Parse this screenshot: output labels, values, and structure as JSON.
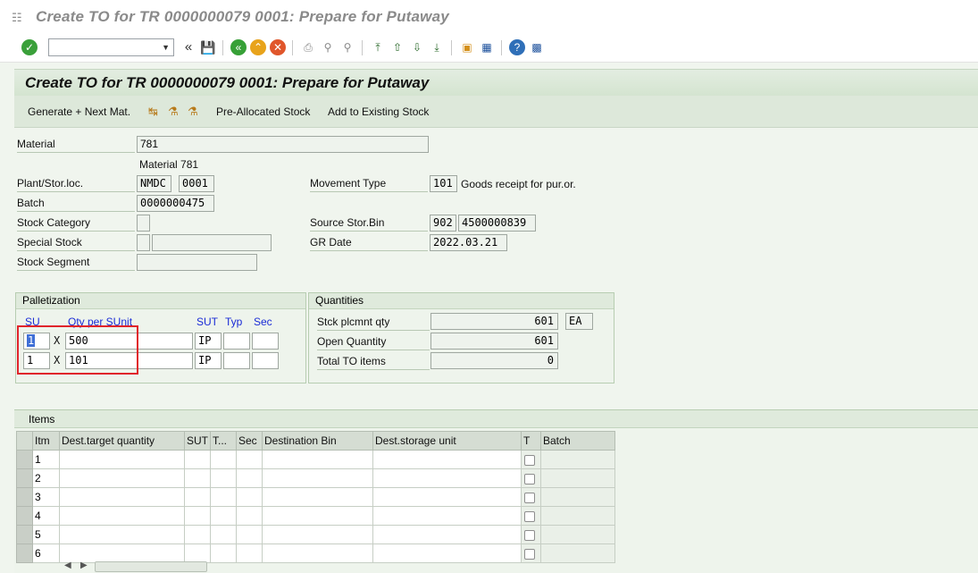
{
  "window": {
    "title": "Create TO for TR 0000000079 0001: Prepare for Putaway"
  },
  "toolbar": {
    "command_value": "",
    "icons": [
      "enter-icon",
      "command-dropdown",
      "back-double-icon",
      "save-icon",
      "back-icon",
      "exit-icon",
      "cancel-icon",
      "print-icon",
      "find-icon",
      "find-next-icon",
      "first-page-icon",
      "prev-page-icon",
      "next-page-icon",
      "last-page-icon",
      "new-session-icon",
      "shortcut-icon",
      "help-icon",
      "customize-icon"
    ]
  },
  "screen": {
    "header": "Create TO for TR 0000000079 0001: Prepare for Putaway"
  },
  "appbar": {
    "generate_next": "Generate + Next Mat.",
    "pre_allocated": "Pre-Allocated Stock",
    "add_existing": "Add to Existing Stock"
  },
  "form": {
    "material_label": "Material",
    "material_value": "781",
    "material_desc": "Material 781",
    "plant_label": "Plant/Stor.loc.",
    "plant_value": "NMDC",
    "sloc_value": "0001",
    "batch_label": "Batch",
    "batch_value": "0000000475",
    "stock_cat_label": "Stock Category",
    "stock_cat_value": "",
    "special_stock_label": "Special Stock",
    "special_stock_value": "",
    "special_stock_value2": "",
    "stock_segment_label": "Stock Segment",
    "stock_segment_value": "",
    "movement_type_label": "Movement Type",
    "movement_type_value": "101",
    "movement_type_desc": "Goods receipt for pur.or.",
    "source_bin_label": "Source Stor.Bin",
    "source_bin_type": "902",
    "source_bin_value": "4500000839",
    "gr_date_label": "GR Date",
    "gr_date_value": "2022.03.21"
  },
  "palletization": {
    "title": "Palletization",
    "col_su": "SU",
    "col_qty": "Qty per SUnit",
    "col_sut": "SUT",
    "col_typ": "Typ",
    "col_sec": "Sec",
    "rows": [
      {
        "su": "1",
        "x": "X",
        "qty": "500",
        "sut": "IP",
        "typ": "",
        "sec": ""
      },
      {
        "su": "1",
        "x": "X",
        "qty": "101",
        "sut": "IP",
        "typ": "",
        "sec": ""
      }
    ]
  },
  "quantities": {
    "title": "Quantities",
    "stck_label": "Stck plcmnt qty",
    "stck_value": "601",
    "stck_unit": "EA",
    "open_label": "Open Quantity",
    "open_value": "601",
    "total_label": "Total TO items",
    "total_value": "0"
  },
  "items": {
    "title": "Items",
    "columns": [
      "Itm",
      "Dest.target quantity",
      "SUT",
      "T...",
      "Sec",
      "Destination Bin",
      "Dest.storage unit",
      "T",
      "Batch"
    ],
    "rows": [
      "1",
      "2",
      "3",
      "4",
      "5",
      "6"
    ]
  },
  "colors": {
    "background": "#f0f5ee",
    "highlight_box": "#e0242b",
    "blue_header": "#1a2bd6"
  }
}
